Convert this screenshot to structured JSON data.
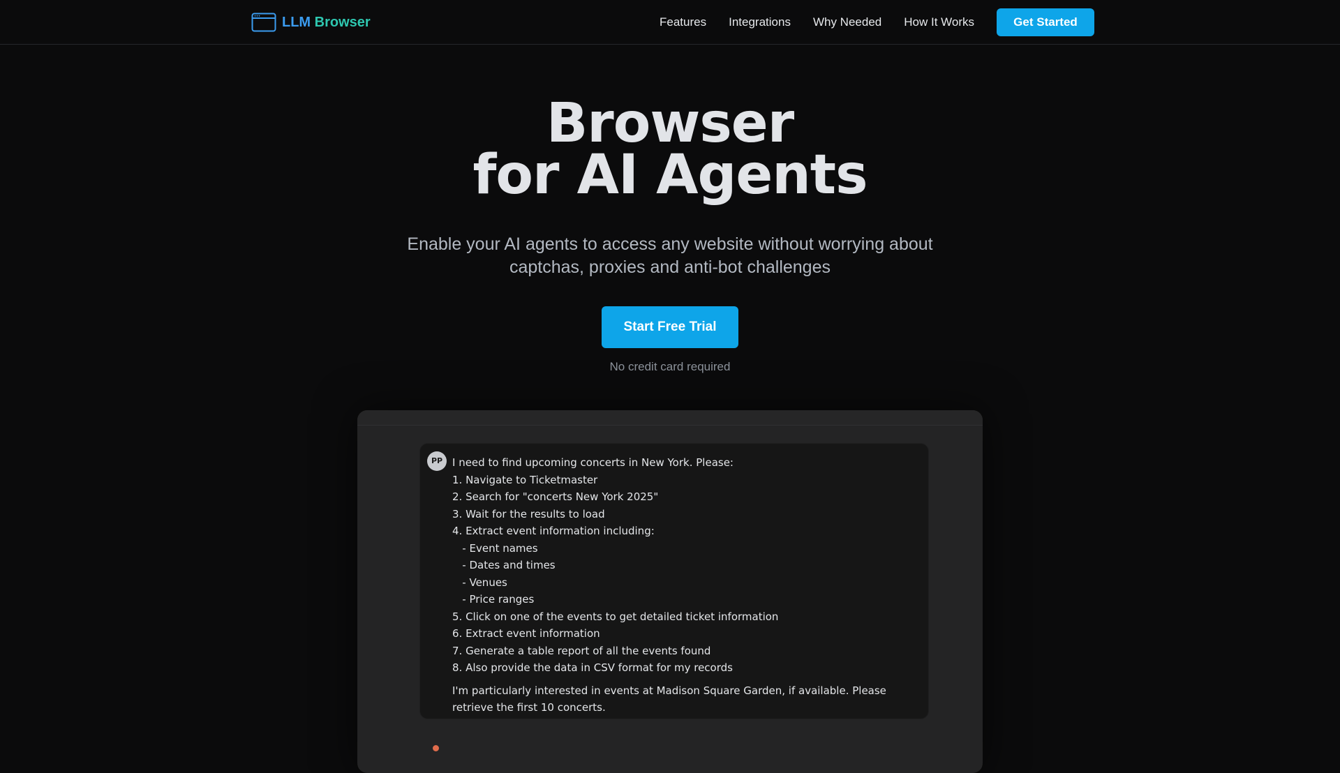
{
  "nav": {
    "brand_llm": "LLM",
    "brand_browser": "Browser",
    "links": [
      "Features",
      "Integrations",
      "Why Needed",
      "How It Works"
    ],
    "cta_label": "Get Started"
  },
  "hero": {
    "title_line1": "Browser",
    "title_line2": "for AI Agents",
    "subtitle": "Enable your AI agents to access any website without worrying about captchas, proxies and anti-bot challenges",
    "cta_label": "Start Free Trial",
    "cta_note": "No credit card required"
  },
  "demo": {
    "avatar_initials": "PP",
    "message_lines": [
      "I need to find upcoming concerts in New York. Please:",
      "1. Navigate to Ticketmaster",
      "2. Search for \"concerts New York 2025\"",
      "3. Wait for the results to load",
      "4. Extract event information including:",
      "   - Event names",
      "   - Dates and times",
      "   - Venues",
      "   - Price ranges",
      "5. Click on one of the events to get detailed ticket information",
      "6. Extract event information",
      "7. Generate a table report of all the events found",
      "8. Also provide the data in CSV format for my records"
    ],
    "message_closing": "I'm particularly interested in events at Madison Square Garden, if available. Please retrieve the first 10 concerts."
  },
  "colors": {
    "background": "#0b0b0c",
    "accent": "#0ea5e9",
    "brand_blue": "#3b9cf0",
    "brand_teal": "#2ec7b0",
    "status_dot": "#e06c4c"
  },
  "icons": {
    "brand": "browser-window-icon"
  }
}
